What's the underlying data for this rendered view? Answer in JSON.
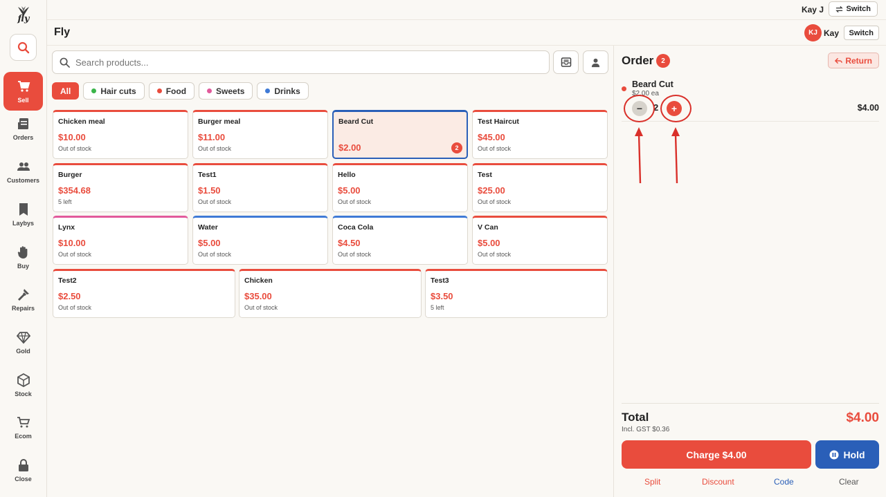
{
  "app": {
    "logo_text": "fly",
    "store_name": "Fly"
  },
  "topbar": {
    "user": "Kay J",
    "switch_label": "Switch"
  },
  "header": {
    "avatar_initials": "KJ",
    "user": "Kay",
    "switch_label": "Switch"
  },
  "sidebar": {
    "items": [
      {
        "label": "Sell",
        "icon": "cart-icon"
      },
      {
        "label": "Orders",
        "icon": "orders-icon"
      },
      {
        "label": "Customers",
        "icon": "customers-icon"
      },
      {
        "label": "Laybys",
        "icon": "bookmark-icon"
      },
      {
        "label": "Buy",
        "icon": "hand-icon"
      },
      {
        "label": "Repairs",
        "icon": "tools-icon"
      },
      {
        "label": "Gold",
        "icon": "diamond-icon"
      },
      {
        "label": "Stock",
        "icon": "box-icon"
      },
      {
        "label": "Ecom",
        "icon": "shop-cart-icon"
      },
      {
        "label": "Close",
        "icon": "lock-icon"
      }
    ]
  },
  "search": {
    "placeholder": "Search products..."
  },
  "categories": [
    {
      "label": "All"
    },
    {
      "label": "Hair cuts",
      "color": "#3bb54a"
    },
    {
      "label": "Food",
      "color": "#e94c3d"
    },
    {
      "label": "Sweets",
      "color": "#e25a9c"
    },
    {
      "label": "Drinks",
      "color": "#3f7ad6"
    }
  ],
  "products": [
    {
      "name": "Chicken meal",
      "price": "$10.00",
      "stock": "Out of stock"
    },
    {
      "name": "Burger meal",
      "price": "$11.00",
      "stock": "Out of stock"
    },
    {
      "name": "Beard Cut",
      "price": "$2.00",
      "stock": "",
      "qty": "2"
    },
    {
      "name": "Test Haircut",
      "price": "$45.00",
      "stock": "Out of stock"
    },
    {
      "name": "Burger",
      "price": "$354.68",
      "stock": "5 left"
    },
    {
      "name": "Test1",
      "price": "$1.50",
      "stock": "Out of stock"
    },
    {
      "name": "Hello",
      "price": "$5.00",
      "stock": "Out of stock"
    },
    {
      "name": "Test",
      "price": "$25.00",
      "stock": "Out of stock"
    },
    {
      "name": "Lynx",
      "price": "$10.00",
      "stock": "Out of stock"
    },
    {
      "name": "Water",
      "price": "$5.00",
      "stock": "Out of stock"
    },
    {
      "name": "Coca Cola",
      "price": "$4.50",
      "stock": "Out of stock"
    },
    {
      "name": "V Can",
      "price": "$5.00",
      "stock": "Out of stock"
    },
    {
      "name": "Test2",
      "price": "$2.50",
      "stock": "Out of stock"
    },
    {
      "name": "Chicken",
      "price": "$35.00",
      "stock": "Out of stock"
    },
    {
      "name": "Test3",
      "price": "$3.50",
      "stock": "5 left"
    }
  ],
  "order": {
    "title": "Order",
    "count": "2",
    "return_label": "Return",
    "item": {
      "name": "Beard Cut",
      "each": "$2.00 ea",
      "qty": "2",
      "total": "$4.00",
      "minus": "−",
      "plus": "+"
    },
    "total_label": "Total",
    "gst": "Incl. GST $0.36",
    "total_value": "$4.00",
    "charge_label": "Charge $4.00",
    "hold_label": "Hold",
    "links": {
      "split": "Split",
      "discount": "Discount",
      "code": "Code",
      "clear": "Clear"
    }
  },
  "colors": {
    "accent": "#e94c3d",
    "blue": "#2a5fb8"
  }
}
